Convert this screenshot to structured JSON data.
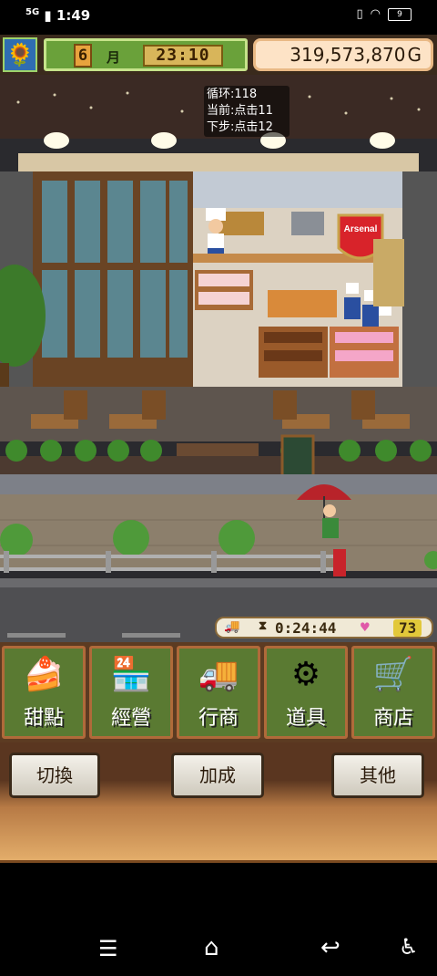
{
  "status_bar": {
    "network": "5G",
    "time": "1:49",
    "battery": "9"
  },
  "hud": {
    "month_value": "6",
    "month_label": "月",
    "clock": "23:10",
    "money": "319,573,870",
    "currency": "G"
  },
  "overlay": {
    "line1": "循环:118",
    "line2": "当前:点击11",
    "line3": "下步:点击12"
  },
  "status_strip": {
    "timer": "0:24:44",
    "hearts": "73"
  },
  "menu": [
    {
      "label": "甜點",
      "icon": "cake-icon"
    },
    {
      "label": "經營",
      "icon": "shop-icon"
    },
    {
      "label": "行商",
      "icon": "truck-icon"
    },
    {
      "label": "道具",
      "icon": "items-icon"
    },
    {
      "label": "商店",
      "icon": "cart-icon"
    }
  ],
  "panel": {
    "switch_label": "切換",
    "speed_label": "加成",
    "other_label": "其他"
  },
  "shop_sign": "Arsenal"
}
